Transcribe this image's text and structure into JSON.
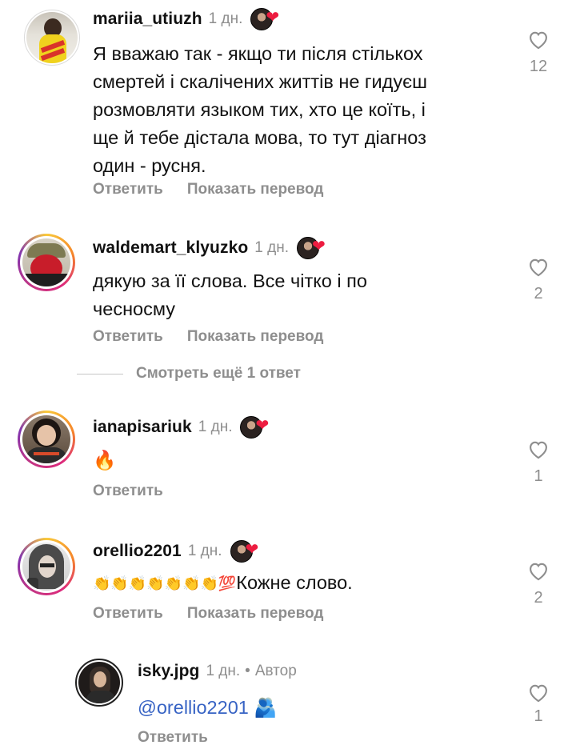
{
  "comments": [
    {
      "username": "mariia_utiuzh",
      "time": "1 дн.",
      "text_lines": [
        "Я вважаю так - якщо ти після стількох",
        "смертей і скалічених життів не гидуєш",
        "розмовляти языком тих, хто це коїть, і",
        "ще й тебе дістала мова, то тут діагноз",
        "один - русня."
      ],
      "reply_label": "Ответить",
      "translate_label": "Показать перевод",
      "likes": "12"
    },
    {
      "username": "waldemart_klyuzko",
      "time": "1 дн.",
      "text_lines": [
        "дякую за її слова. Все чітко і по",
        "чесносму"
      ],
      "reply_label": "Ответить",
      "translate_label": "Показать перевод",
      "likes": "2"
    },
    {
      "username": "ianapisariuk",
      "time": "1 дн.",
      "text": "🔥",
      "reply_label": "Ответить",
      "likes": "1"
    },
    {
      "username": "orellio2201",
      "time": "1 дн.",
      "emoji_prefix": "👏👏👏👏👏👏👏💯",
      "text": "Кожне слово.",
      "reply_label": "Ответить",
      "translate_label": "Показать перевод",
      "likes": "2"
    },
    {
      "username": "isky.jpg",
      "time": "1 дн.",
      "dot": "•",
      "author_label": "Автор",
      "mention": "@orellio2201",
      "emoji_suffix": "🫂",
      "reply_label": "Ответить",
      "likes": "1"
    }
  ],
  "more_replies_label": "Смотреть ещё 1 ответ",
  "icons": {
    "like": "heart-outline-icon",
    "creator_liked": "creator-liked-heart-icon"
  },
  "colors": {
    "text": "#121212",
    "secondary": "#8e8e8e",
    "mention": "#3763c4",
    "heart_red": "#ed1c40"
  }
}
